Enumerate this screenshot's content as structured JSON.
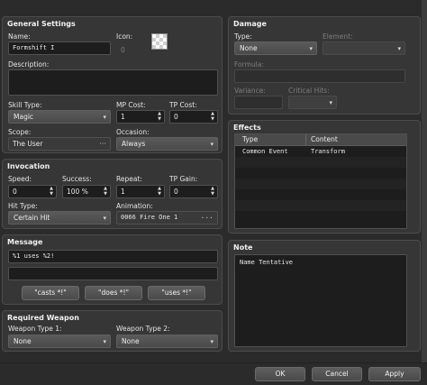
{
  "general": {
    "title": "General Settings",
    "name_label": "Name:",
    "name_value": "Formshift I",
    "icon_label": "Icon:",
    "icon_index": "0",
    "description_label": "Description:",
    "description_value": "",
    "skill_type_label": "Skill Type:",
    "skill_type_value": "Magic",
    "mp_cost_label": "MP Cost:",
    "mp_cost_value": "1",
    "tp_cost_label": "TP Cost:",
    "tp_cost_value": "0",
    "scope_label": "Scope:",
    "scope_value": "The User",
    "occasion_label": "Occasion:",
    "occasion_value": "Always"
  },
  "invocation": {
    "title": "Invocation",
    "speed_label": "Speed:",
    "speed_value": "0",
    "success_label": "Success:",
    "success_value": "100 %",
    "repeat_label": "Repeat:",
    "repeat_value": "1",
    "tp_gain_label": "TP Gain:",
    "tp_gain_value": "0",
    "hit_type_label": "Hit Type:",
    "hit_type_value": "Certain Hit",
    "animation_label": "Animation:",
    "animation_value": "0066 Fire One 1"
  },
  "message": {
    "title": "Message",
    "line1": "%1 uses %2!",
    "line2": "",
    "btn_casts": "\"casts *!\"",
    "btn_does": "\"does *!\"",
    "btn_uses": "\"uses *!\""
  },
  "weapon": {
    "title": "Required Weapon",
    "type1_label": "Weapon Type 1:",
    "type1_value": "None",
    "type2_label": "Weapon Type 2:",
    "type2_value": "None"
  },
  "damage": {
    "title": "Damage",
    "type_label": "Type:",
    "type_value": "None",
    "element_label": "Element:",
    "element_value": "",
    "formula_label": "Formula:",
    "formula_value": "",
    "variance_label": "Variance:",
    "variance_value": "",
    "critical_label": "Critical Hits:",
    "critical_value": ""
  },
  "effects": {
    "title": "Effects",
    "col_type": "Type",
    "col_content": "Content",
    "rows": [
      {
        "type": "Common Event",
        "content": "Transform"
      }
    ]
  },
  "note": {
    "title": "Note",
    "value": "Name Tentative"
  },
  "footer": {
    "ok": "OK",
    "cancel": "Cancel",
    "apply": "Apply"
  }
}
